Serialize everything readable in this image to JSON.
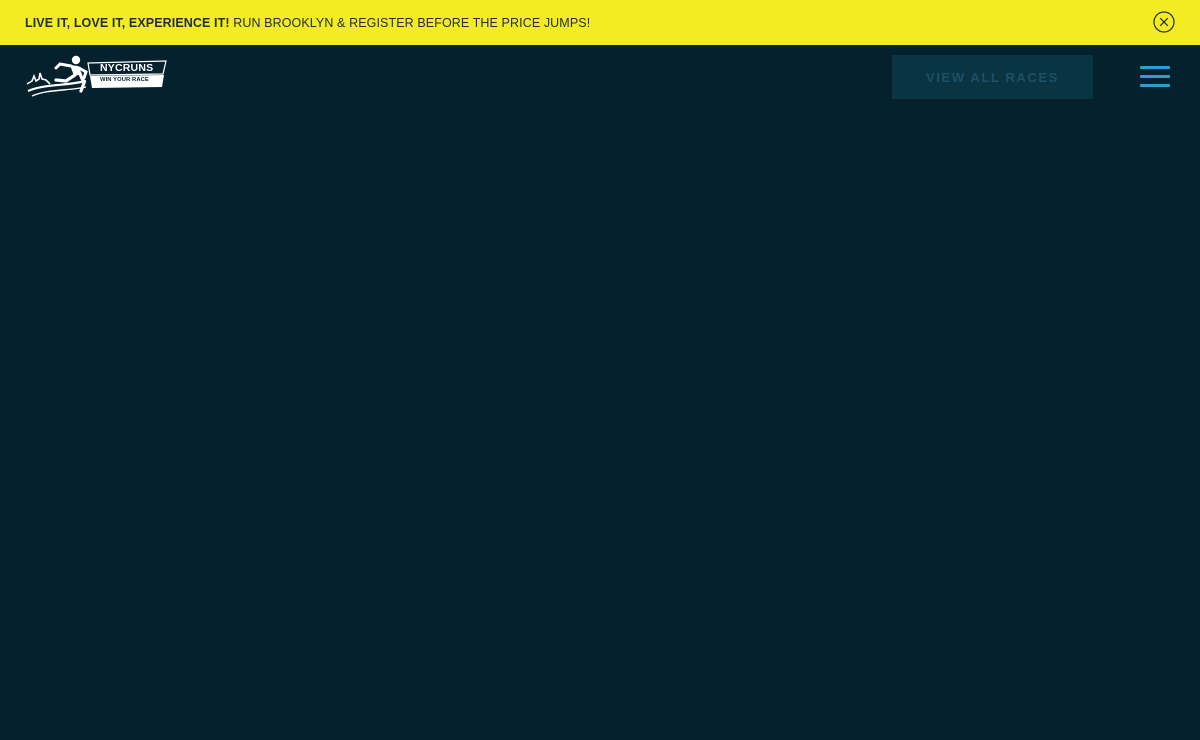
{
  "promo": {
    "bold_text": "LIVE IT, LOVE IT, EXPERIENCE IT!",
    "normal_text": " RUN BROOKLYN & REGISTER BEFORE THE PRICE JUMPS!",
    "background_color": "#f3ec23",
    "close_icon": "close-circle-icon"
  },
  "header": {
    "logo": {
      "brand_name": "NYCRUNS",
      "tagline": "WIN YOUR RACE",
      "icon": "runner-skyline-icon"
    },
    "view_all_label": "VIEW ALL RACES",
    "menu_icon": "hamburger-menu-icon",
    "accent_color": "#2a9fd6",
    "background_color": "#05212d"
  }
}
